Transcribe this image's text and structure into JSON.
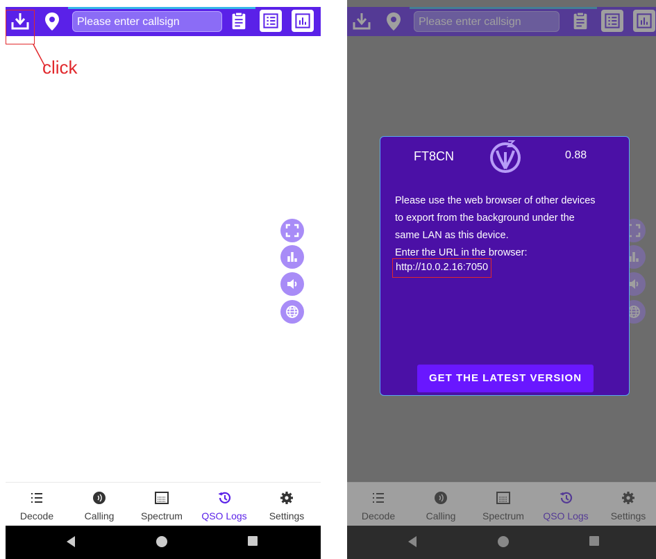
{
  "topbar": {
    "callsign_placeholder": "Please enter callsign"
  },
  "annotation": {
    "text": "click"
  },
  "nav": [
    {
      "label": "Decode",
      "icon": "list-icon",
      "active": false
    },
    {
      "label": "Calling",
      "icon": "calling-icon",
      "active": false
    },
    {
      "label": "Spectrum",
      "icon": "spectrum-icon",
      "active": false
    },
    {
      "label": "QSO Logs",
      "icon": "history-icon",
      "active": true
    },
    {
      "label": "Settings",
      "icon": "gear-icon",
      "active": false
    }
  ],
  "dialog": {
    "app_name": "FT8CN",
    "version": "0.88",
    "line1": "Please use the web browser of other devices",
    "line2": "to export from the background under the",
    "line3": "same LAN as this device.",
    "line4": "Enter the URL in the browser:",
    "url": "http://10.0.2.16:7050",
    "button_label": "GET THE LATEST VERSION"
  },
  "colors": {
    "primary": "#5a21e8",
    "fab": "#a88cf7",
    "dialog_bg": "#4b10a6",
    "button": "#6917ff",
    "annotation": "#e1282c"
  }
}
